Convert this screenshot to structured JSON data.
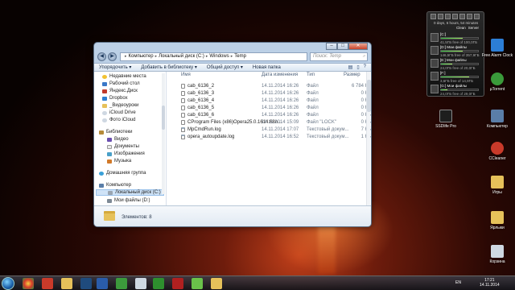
{
  "window": {
    "address": [
      "Компьютер",
      "Локальный диск (C:)",
      "Windows",
      "Temp"
    ],
    "search_placeholder": "Поиск: Temp",
    "toolbar": [
      "Упорядочить ▾",
      "Добавить в библиотеку ▾",
      "Общий доступ ▾",
      "Новая папка"
    ],
    "columns": {
      "name": "Имя",
      "date": "Дата изменения",
      "type": "Тип",
      "size": "Размер"
    },
    "nav": {
      "favorites": [
        "Недавние места",
        "Рабочий стол",
        "Яндекс.Диск",
        "Dropbox",
        "_Видеоуроки",
        "iCloud Drive",
        "Фото iCloud"
      ],
      "libraries": "Библиотеки",
      "library_items": [
        "Видео",
        "Документы",
        "Изображения",
        "Музыка"
      ],
      "homegroup": "Домашняя группа",
      "computer": "Компьютер",
      "drives": [
        "Локальный диск (C:)",
        "Мои файлы (D:)"
      ]
    },
    "files": [
      {
        "name": "cab_6136_2",
        "date": "14.11.2014 16:26",
        "type": "Файл",
        "size": "6 784 КБ"
      },
      {
        "name": "cab_6136_3",
        "date": "14.11.2014 16:26",
        "type": "Файл",
        "size": "0 КБ"
      },
      {
        "name": "cab_6136_4",
        "date": "14.11.2014 16:26",
        "type": "Файл",
        "size": "0 КБ"
      },
      {
        "name": "cab_6136_5",
        "date": "14.11.2014 16:26",
        "type": "Файл",
        "size": "0 КБ"
      },
      {
        "name": "cab_6136_6",
        "date": "14.11.2014 16:26",
        "type": "Файл",
        "size": "0 КБ"
      },
      {
        "name": "CProgram Files (x86)Opera25.0.1614.68o...",
        "date": "14.11.2014 15:09",
        "type": "Файл \"LOCK\"",
        "size": "0 КБ"
      },
      {
        "name": "MpCmdRun.log",
        "date": "14.11.2014 17:07",
        "type": "Текстовый докум...",
        "size": "7 КБ"
      },
      {
        "name": "opera_autoupdate.log",
        "date": "14.11.2014 16:52",
        "type": "Текстовый докум...",
        "size": "1 КБ"
      }
    ],
    "status": "Элементов: 8"
  },
  "gadget": {
    "uptime": "0 days, 6 hours, 54 minutes",
    "tabs": [
      "Clean",
      "Server"
    ],
    "drives": [
      {
        "label": "[C:]",
        "free": "41,5ГБ free of 100,0ГБ",
        "fill": 0.58
      },
      {
        "label": "[D:] Мои файлы",
        "free": "146,5ГБ free of 357,9ГБ",
        "fill": 0.59
      },
      {
        "label": "[E:] Мои файлы",
        "free": "24,0ГБ free of 20,0ГБ",
        "fill": 0.3
      },
      {
        "label": "[F:]",
        "free": "3,6ГБ free of 14,9ГБ",
        "fill": 0.76
      },
      {
        "label": "[G:] Мои файлы",
        "free": "24,0ГБ free of 29,0ГБ",
        "fill": 0.17
      }
    ]
  },
  "desktop_icons": [
    "Free Alarm Clock",
    "µTorrent",
    "SSDlife Pro",
    "Компьютер",
    "CCleaner",
    "Игры",
    "Ярлыки",
    "Корзина"
  ],
  "taskbar": {
    "lang": "EN",
    "time": "17:21",
    "date": "14.11.2014"
  }
}
